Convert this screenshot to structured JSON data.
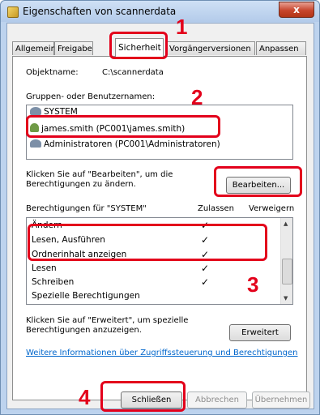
{
  "window": {
    "title": "Eigenschaften von scannerdata",
    "close_label": "x"
  },
  "tabs": [
    {
      "label": "Allgemein"
    },
    {
      "label": "Freigabe"
    },
    {
      "label": "Sicherheit"
    },
    {
      "label": "Vorgängerversionen"
    },
    {
      "label": "Anpassen"
    }
  ],
  "object": {
    "name_label": "Objektname:",
    "name_value": "C:\\scannerdata"
  },
  "groups": {
    "label": "Gruppen- oder Benutzernamen:",
    "items": [
      {
        "label": "SYSTEM"
      },
      {
        "label": "james.smith (PC001\\james.smith)"
      },
      {
        "label": "Administratoren (PC001\\Administratoren)"
      }
    ]
  },
  "edit": {
    "hint": "Klicken Sie auf \"Bearbeiten\", um die\nBerechtigungen zu ändern.",
    "button_label": "Bearbeiten..."
  },
  "permissions": {
    "header": "Berechtigungen für \"SYSTEM\"",
    "allow_label": "Zulassen",
    "deny_label": "Verweigern",
    "rows": [
      {
        "name": "Ändern",
        "allow": "✓"
      },
      {
        "name": "Lesen, Ausführen",
        "allow": "✓"
      },
      {
        "name": "Ordnerinhalt anzeigen",
        "allow": "✓"
      },
      {
        "name": "Lesen",
        "allow": "✓"
      },
      {
        "name": "Schreiben",
        "allow": "✓"
      },
      {
        "name": "Spezielle Berechtigungen",
        "allow": ""
      }
    ]
  },
  "advanced": {
    "hint": "Klicken Sie auf \"Erweitert\", um spezielle\nBerechtigungen anzuzeigen.",
    "button_label": "Erweitert"
  },
  "info_link": "Weitere Informationen über Zugriffssteuerung und Berechtigungen",
  "footer": {
    "close_label": "Schließen",
    "cancel_label": "Abbrechen",
    "apply_label": "Übernehmen"
  },
  "callouts": [
    "1",
    "2",
    "3",
    "4"
  ],
  "colors": {
    "highlight": "#e3001b",
    "link": "#0066cc"
  }
}
